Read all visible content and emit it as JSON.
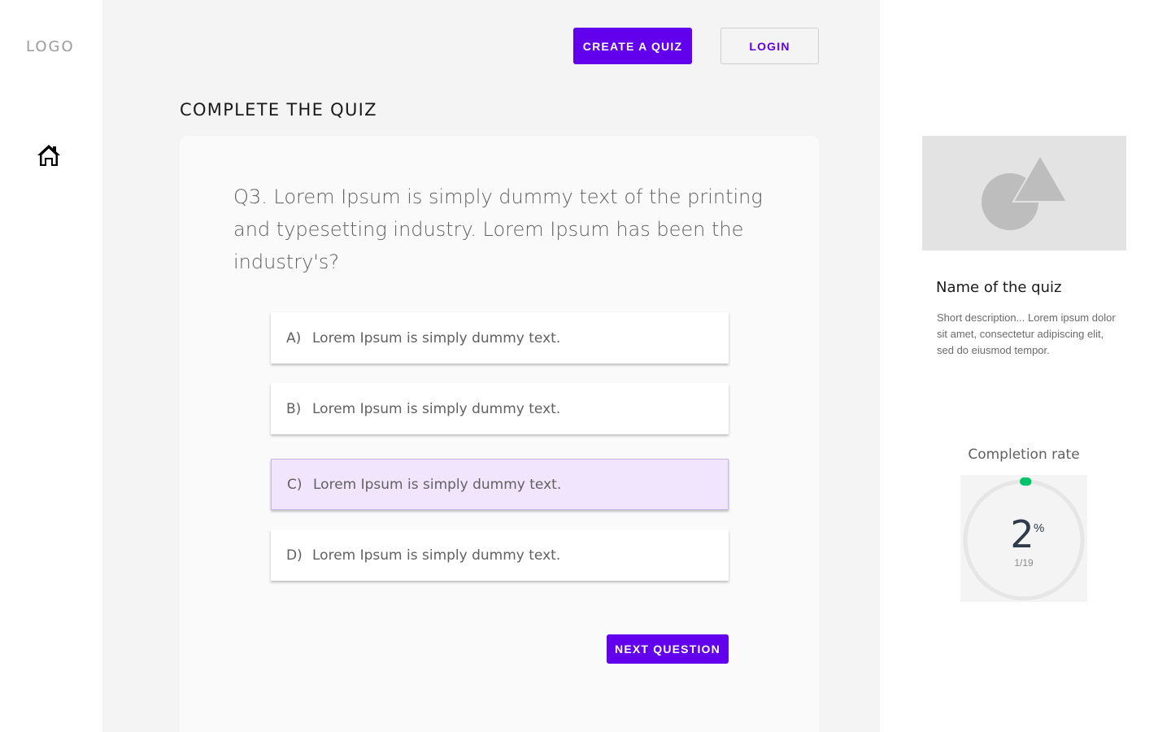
{
  "sidebar": {
    "logo": "LOGO",
    "home_icon": "home-icon"
  },
  "header": {
    "create_quiz_label": "CREATE A QUIZ",
    "login_label": "LOGIN"
  },
  "main": {
    "title": "COMPLETE THE QUIZ",
    "question": "Q3. Lorem Ipsum is simply dummy text of the printing and typesetting industry. Lorem Ipsum has been the industry's?",
    "options": [
      {
        "letter": "A)",
        "text": "Lorem Ipsum is simply dummy text.",
        "selected": false
      },
      {
        "letter": "B)",
        "text": "Lorem Ipsum is simply dummy text.",
        "selected": false
      },
      {
        "letter": "C)",
        "text": "Lorem Ipsum is simply dummy text.",
        "selected": true
      },
      {
        "letter": "D)",
        "text": "Lorem Ipsum is simply dummy text.",
        "selected": false
      }
    ],
    "next_label": "NEXT QUESTION"
  },
  "quiz_info": {
    "thumbnail_icon": "image-placeholder-icon",
    "name": "Name of the quiz",
    "description": "Short description... Lorem ipsum dolor sit amet, consectetur adipiscing elit, sed do eiusmod tempor."
  },
  "completion": {
    "label": "Completion rate",
    "percent": "2",
    "percent_sign": "%",
    "fraction": "1/19",
    "progress_ratio": 0.02
  },
  "colors": {
    "accent": "#6200ee",
    "selected_option_bg": "#f1e5fd",
    "progress": "#00c46a",
    "track": "#e6e6e6"
  }
}
